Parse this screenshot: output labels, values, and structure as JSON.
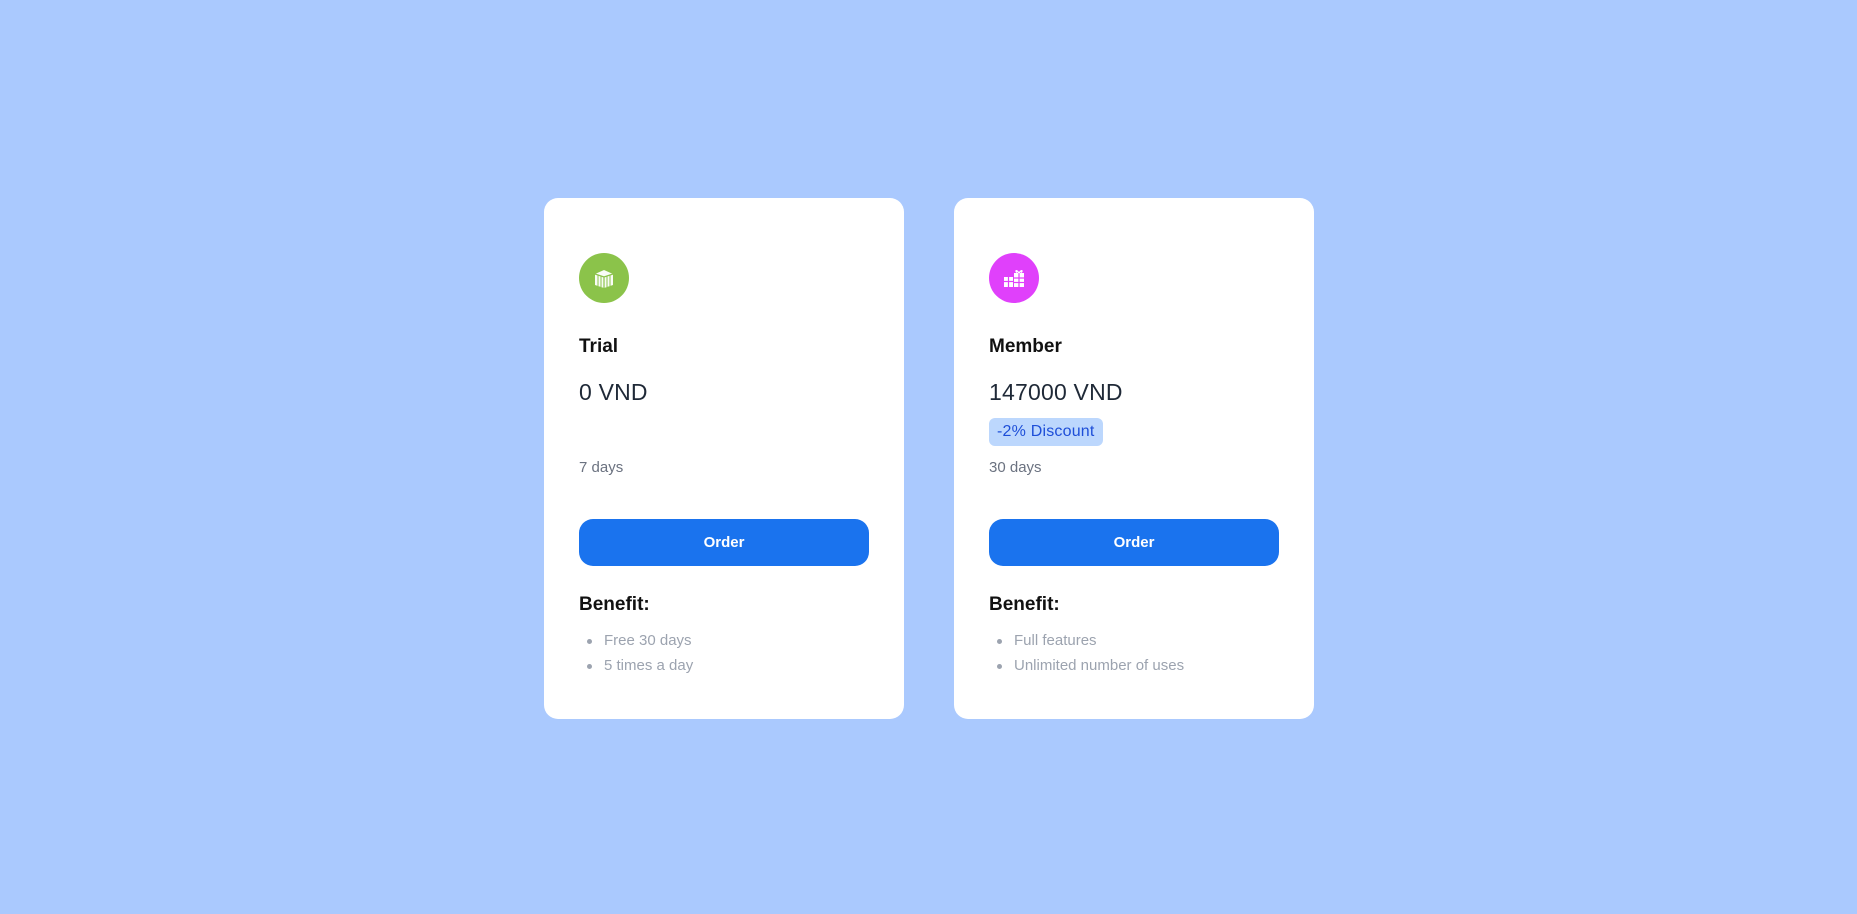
{
  "plans": [
    {
      "name": "Trial",
      "price": "0 VND",
      "discount": "",
      "duration": "7 days",
      "order_label": "Order",
      "benefit_title": "Benefit:",
      "benefits": [
        "Free 30 days",
        "5 times a day"
      ],
      "icon": "box-icon",
      "icon_color": "#8bc34a"
    },
    {
      "name": "Member",
      "price": "147000 VND",
      "discount": "-2% Discount",
      "duration": "30 days",
      "order_label": "Order",
      "benefit_title": "Benefit:",
      "benefits": [
        "Full features",
        "Unlimited number of uses"
      ],
      "icon": "gifts-icon",
      "icon_color": "#e040fb"
    }
  ],
  "colors": {
    "background": "#aac9fe",
    "accent": "#1a73ee",
    "badge_bg": "#bcd7fd",
    "badge_text": "#1d4ed8"
  }
}
